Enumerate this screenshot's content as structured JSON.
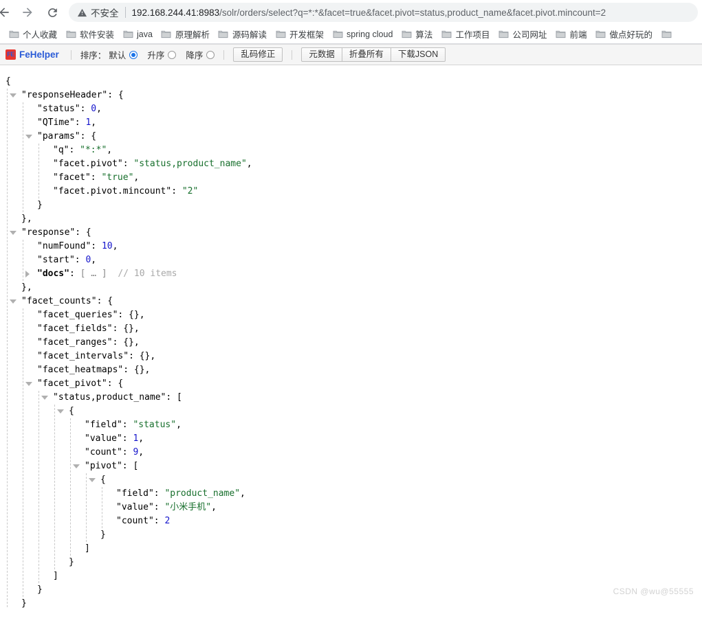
{
  "browser": {
    "nav": {
      "back_label": "back-arrow",
      "forward_label": "forward-arrow",
      "reload_label": "reload"
    },
    "omnibox": {
      "security_label": "不安全",
      "url_host": "192.168.244.41:8983",
      "url_path": "/solr/orders/select?q=*:*&facet=true&facet.pivot=status,product_name&facet.pivot.mincount=2",
      "url_full": "192.168.244.41:8983/solr/orders/select?q=*:*&facet=true&facet.pivot=status,product_name&facet.pivot.mincount=2"
    },
    "bookmarks": [
      {
        "label": "个人收藏"
      },
      {
        "label": "软件安装"
      },
      {
        "label": "java"
      },
      {
        "label": "原理解析"
      },
      {
        "label": "源码解读"
      },
      {
        "label": "开发框架"
      },
      {
        "label": "spring cloud"
      },
      {
        "label": "算法"
      },
      {
        "label": "工作项目"
      },
      {
        "label": "公司网址"
      },
      {
        "label": "前端"
      },
      {
        "label": "做点好玩的"
      },
      {
        "label": ""
      }
    ]
  },
  "fehelper": {
    "logo_text": "FE",
    "brand": "FeHelper",
    "sort_label": "排序：",
    "sort_options": [
      {
        "label": "默认",
        "checked": true
      },
      {
        "label": "升序",
        "checked": false
      },
      {
        "label": "降序",
        "checked": false
      }
    ],
    "fix_button": "乱码修正",
    "actions": [
      {
        "label": "元数据"
      },
      {
        "label": "折叠所有"
      },
      {
        "label": "下载JSON"
      }
    ]
  },
  "json_lines": [
    {
      "indent": 0,
      "tri": null,
      "parts": [
        {
          "c": "p",
          "t": "{"
        }
      ]
    },
    {
      "indent": 1,
      "tri": "open",
      "parts": [
        {
          "c": "k",
          "t": "\"responseHeader\""
        },
        {
          "c": "p",
          "t": ": {"
        }
      ]
    },
    {
      "indent": 2,
      "tri": null,
      "parts": [
        {
          "c": "k",
          "t": "\"status\""
        },
        {
          "c": "p",
          "t": ": "
        },
        {
          "c": "num",
          "t": "0"
        },
        {
          "c": "p",
          "t": ","
        }
      ]
    },
    {
      "indent": 2,
      "tri": null,
      "parts": [
        {
          "c": "k",
          "t": "\"QTime\""
        },
        {
          "c": "p",
          "t": ": "
        },
        {
          "c": "num",
          "t": "1"
        },
        {
          "c": "p",
          "t": ","
        }
      ]
    },
    {
      "indent": 2,
      "tri": "open",
      "parts": [
        {
          "c": "k",
          "t": "\"params\""
        },
        {
          "c": "p",
          "t": ": {"
        }
      ]
    },
    {
      "indent": 3,
      "tri": null,
      "parts": [
        {
          "c": "k",
          "t": "\"q\""
        },
        {
          "c": "p",
          "t": ": "
        },
        {
          "c": "s",
          "t": "\"*:*\""
        },
        {
          "c": "p",
          "t": ","
        }
      ]
    },
    {
      "indent": 3,
      "tri": null,
      "parts": [
        {
          "c": "k",
          "t": "\"facet.pivot\""
        },
        {
          "c": "p",
          "t": ": "
        },
        {
          "c": "s",
          "t": "\"status,product_name\""
        },
        {
          "c": "p",
          "t": ","
        }
      ]
    },
    {
      "indent": 3,
      "tri": null,
      "parts": [
        {
          "c": "k",
          "t": "\"facet\""
        },
        {
          "c": "p",
          "t": ": "
        },
        {
          "c": "s",
          "t": "\"true\""
        },
        {
          "c": "p",
          "t": ","
        }
      ]
    },
    {
      "indent": 3,
      "tri": null,
      "parts": [
        {
          "c": "k",
          "t": "\"facet.pivot.mincount\""
        },
        {
          "c": "p",
          "t": ": "
        },
        {
          "c": "s",
          "t": "\"2\""
        }
      ]
    },
    {
      "indent": 2,
      "tri": null,
      "parts": [
        {
          "c": "p",
          "t": "}"
        }
      ]
    },
    {
      "indent": 1,
      "tri": null,
      "parts": [
        {
          "c": "p",
          "t": "},"
        }
      ]
    },
    {
      "indent": 1,
      "tri": "open",
      "parts": [
        {
          "c": "k",
          "t": "\"response\""
        },
        {
          "c": "p",
          "t": ": {"
        }
      ]
    },
    {
      "indent": 2,
      "tri": null,
      "parts": [
        {
          "c": "k",
          "t": "\"numFound\""
        },
        {
          "c": "p",
          "t": ": "
        },
        {
          "c": "num",
          "t": "10"
        },
        {
          "c": "p",
          "t": ","
        }
      ]
    },
    {
      "indent": 2,
      "tri": null,
      "parts": [
        {
          "c": "k",
          "t": "\"start\""
        },
        {
          "c": "p",
          "t": ": "
        },
        {
          "c": "num",
          "t": "0"
        },
        {
          "c": "p",
          "t": ","
        }
      ]
    },
    {
      "indent": 2,
      "tri": "closed",
      "parts": [
        {
          "c": "k-bold",
          "t": "\"docs\""
        },
        {
          "c": "p",
          "t": ": "
        },
        {
          "c": "brk-gray",
          "t": "[ … ]"
        },
        {
          "c": "cmt",
          "t": "  // 10 items"
        }
      ]
    },
    {
      "indent": 1,
      "tri": null,
      "parts": [
        {
          "c": "p",
          "t": "},"
        }
      ]
    },
    {
      "indent": 1,
      "tri": "open",
      "parts": [
        {
          "c": "k",
          "t": "\"facet_counts\""
        },
        {
          "c": "p",
          "t": ": {"
        }
      ]
    },
    {
      "indent": 2,
      "tri": null,
      "parts": [
        {
          "c": "k",
          "t": "\"facet_queries\""
        },
        {
          "c": "p",
          "t": ": {},"
        }
      ]
    },
    {
      "indent": 2,
      "tri": null,
      "parts": [
        {
          "c": "k",
          "t": "\"facet_fields\""
        },
        {
          "c": "p",
          "t": ": {},"
        }
      ]
    },
    {
      "indent": 2,
      "tri": null,
      "parts": [
        {
          "c": "k",
          "t": "\"facet_ranges\""
        },
        {
          "c": "p",
          "t": ": {},"
        }
      ]
    },
    {
      "indent": 2,
      "tri": null,
      "parts": [
        {
          "c": "k",
          "t": "\"facet_intervals\""
        },
        {
          "c": "p",
          "t": ": {},"
        }
      ]
    },
    {
      "indent": 2,
      "tri": null,
      "parts": [
        {
          "c": "k",
          "t": "\"facet_heatmaps\""
        },
        {
          "c": "p",
          "t": ": {},"
        }
      ]
    },
    {
      "indent": 2,
      "tri": "open",
      "parts": [
        {
          "c": "k",
          "t": "\"facet_pivot\""
        },
        {
          "c": "p",
          "t": ": {"
        }
      ]
    },
    {
      "indent": 3,
      "tri": "open",
      "parts": [
        {
          "c": "k",
          "t": "\"status,product_name\""
        },
        {
          "c": "p",
          "t": ": ["
        }
      ]
    },
    {
      "indent": 4,
      "tri": "open",
      "parts": [
        {
          "c": "p",
          "t": "{"
        }
      ]
    },
    {
      "indent": 5,
      "tri": null,
      "parts": [
        {
          "c": "k",
          "t": "\"field\""
        },
        {
          "c": "p",
          "t": ": "
        },
        {
          "c": "s",
          "t": "\"status\""
        },
        {
          "c": "p",
          "t": ","
        }
      ]
    },
    {
      "indent": 5,
      "tri": null,
      "parts": [
        {
          "c": "k",
          "t": "\"value\""
        },
        {
          "c": "p",
          "t": ": "
        },
        {
          "c": "num",
          "t": "1"
        },
        {
          "c": "p",
          "t": ","
        }
      ]
    },
    {
      "indent": 5,
      "tri": null,
      "parts": [
        {
          "c": "k",
          "t": "\"count\""
        },
        {
          "c": "p",
          "t": ": "
        },
        {
          "c": "num",
          "t": "9"
        },
        {
          "c": "p",
          "t": ","
        }
      ]
    },
    {
      "indent": 5,
      "tri": "open",
      "parts": [
        {
          "c": "k",
          "t": "\"pivot\""
        },
        {
          "c": "p",
          "t": ": ["
        }
      ]
    },
    {
      "indent": 6,
      "tri": "open",
      "parts": [
        {
          "c": "p",
          "t": "{"
        }
      ]
    },
    {
      "indent": 7,
      "tri": null,
      "parts": [
        {
          "c": "k",
          "t": "\"field\""
        },
        {
          "c": "p",
          "t": ": "
        },
        {
          "c": "s",
          "t": "\"product_name\""
        },
        {
          "c": "p",
          "t": ","
        }
      ]
    },
    {
      "indent": 7,
      "tri": null,
      "parts": [
        {
          "c": "k",
          "t": "\"value\""
        },
        {
          "c": "p",
          "t": ": "
        },
        {
          "c": "s",
          "t": "\"小米手机\""
        },
        {
          "c": "p",
          "t": ","
        }
      ]
    },
    {
      "indent": 7,
      "tri": null,
      "parts": [
        {
          "c": "k",
          "t": "\"count\""
        },
        {
          "c": "p",
          "t": ": "
        },
        {
          "c": "num",
          "t": "2"
        }
      ]
    },
    {
      "indent": 6,
      "tri": null,
      "parts": [
        {
          "c": "p",
          "t": "}"
        }
      ]
    },
    {
      "indent": 5,
      "tri": null,
      "parts": [
        {
          "c": "p",
          "t": "]"
        }
      ]
    },
    {
      "indent": 4,
      "tri": null,
      "parts": [
        {
          "c": "p",
          "t": "}"
        }
      ]
    },
    {
      "indent": 3,
      "tri": null,
      "parts": [
        {
          "c": "p",
          "t": "]"
        }
      ]
    },
    {
      "indent": 2,
      "tri": null,
      "parts": [
        {
          "c": "p",
          "t": "}"
        }
      ]
    },
    {
      "indent": 1,
      "tri": null,
      "parts": [
        {
          "c": "p",
          "t": "}"
        }
      ]
    },
    {
      "indent": 0,
      "tri": null,
      "parts": [
        {
          "c": "p",
          "t": "}"
        }
      ]
    }
  ],
  "watermark": "CSDN @wu@55555",
  "colors": {
    "string": "#176f2c",
    "number": "#1414cc",
    "key": "#000000",
    "comment": "#a8a8a8",
    "accent": "#1a73e8",
    "brand": "#2a5bd7"
  }
}
